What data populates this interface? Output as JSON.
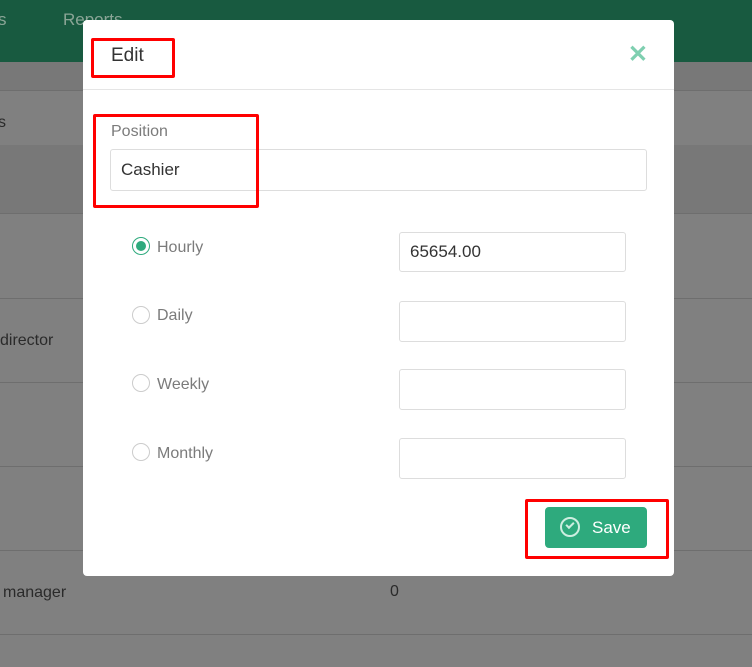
{
  "nav": {
    "items": [
      "s",
      "Reports"
    ]
  },
  "background": {
    "rows": [
      "s",
      "director",
      "manager"
    ],
    "values": [
      "0"
    ]
  },
  "modal": {
    "title": "Edit",
    "position_label": "Position",
    "position_value": "Cashier",
    "rates": [
      {
        "label": "Hourly",
        "selected": true,
        "value": "65654.00"
      },
      {
        "label": "Daily",
        "selected": false,
        "value": ""
      },
      {
        "label": "Weekly",
        "selected": false,
        "value": ""
      },
      {
        "label": "Monthly",
        "selected": false,
        "value": ""
      }
    ],
    "save_label": "Save"
  },
  "colors": {
    "accent": "#2eaa7d",
    "topbar": "#185a40",
    "highlight": "#ff0000"
  }
}
